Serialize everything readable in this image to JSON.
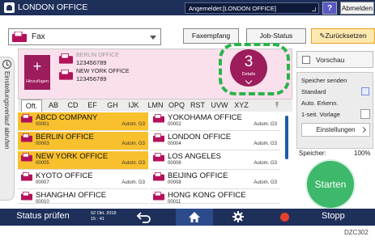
{
  "titlebar": {
    "title": "LONDON OFFICE",
    "login": "Angemeldet:[LONDON OFFICE]",
    "help": "?",
    "logout": "Abmelden"
  },
  "toolbar": {
    "mode": "Fax",
    "faxempfang": "Faxempfang",
    "jobstatus": "Job-Status",
    "reset": "Zurücksetzen"
  },
  "history_tab": {
    "label": "Einstellungsverlauf abrufen"
  },
  "destinations": {
    "add_label": "Hinzufügen",
    "entries": [
      {
        "name": "BERLIN OFFICE",
        "number": "123456789"
      },
      {
        "name": "NEW YORK OFFICE",
        "number": "123456789"
      }
    ],
    "count": "3",
    "details_label": "Details"
  },
  "tabs": [
    "Oft.",
    "AB",
    "CD",
    "EF",
    "GH",
    "IJK",
    "LMN",
    "OPQ",
    "RST",
    "UVW",
    "XYZ"
  ],
  "address_book": [
    {
      "name": "ABCD COMPANY",
      "number": "00001",
      "type": "Autom. G3",
      "selected": true
    },
    {
      "name": "YOKOHAMA OFFICE",
      "number": "00002",
      "type": "Autom. G3",
      "selected": false
    },
    {
      "name": "BERLIN OFFICE",
      "number": "00003",
      "type": "Autom. G3",
      "selected": true
    },
    {
      "name": "LONDON OFFICE",
      "number": "00004",
      "type": "Autom. G3",
      "selected": false
    },
    {
      "name": "NEW YORK OFFICE",
      "number": "00005",
      "type": "Autom. G3",
      "selected": true
    },
    {
      "name": "LOS ANGELES",
      "number": "00006",
      "type": "Autom. G3",
      "selected": false
    },
    {
      "name": "KYOTO OFFICE",
      "number": "00007",
      "type": "Autom. G3",
      "selected": false
    },
    {
      "name": "BEIJING OFFICE",
      "number": "00008",
      "type": "Autom. G3",
      "selected": false
    },
    {
      "name": "SHANGHAI OFFICE",
      "number": "00010",
      "type": "",
      "selected": false
    },
    {
      "name": "HONG KONG OFFICE",
      "number": "00011",
      "type": "",
      "selected": false
    }
  ],
  "right_panel": {
    "preview": "Vorschau",
    "settings": [
      "Speicher senden",
      "Standard",
      "Auto. Erkenn.",
      "1-seit. Vorlage"
    ],
    "einstellungen": "Einstellungen",
    "speicher_label": "Speicher:",
    "speicher_value": "100%",
    "start": "Starten"
  },
  "bottombar": {
    "status": "Status prüfen",
    "date": "02 Okt. 2018",
    "time": "15 : 41",
    "stop": "Stopp"
  },
  "figure_code": "DZC302",
  "colors": {
    "accent": "#9c1c5c",
    "highlight": "#2bb34a",
    "selected": "#f8c02d",
    "bar": "#1e2f5a"
  }
}
